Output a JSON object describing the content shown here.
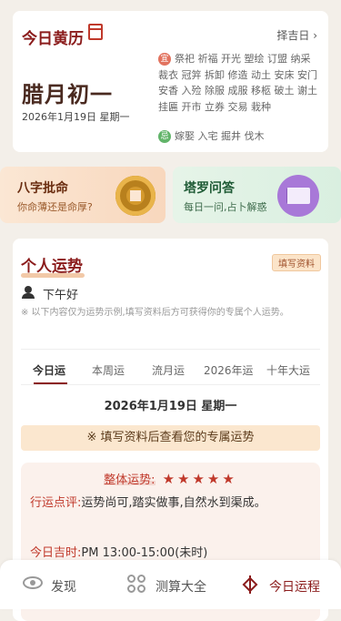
{
  "huangli": {
    "title": "今日黄历",
    "link": "择吉日 ›",
    "lunar": "腊月初一",
    "date": "2026年1月19日 星期一",
    "yi_badge": "宜",
    "yi": "祭祀 祈福 开光 塑绘 订盟 纳采 裁衣 冠笄 拆卸 修造 动土 安床 安门 安香 入殓 除服 成服 移柩 破土 谢土 挂匾 开市 立券 交易 栽种",
    "ji_badge": "忌",
    "ji": "嫁娶 入宅 掘井 伐木"
  },
  "promo_bazi": {
    "title": "八字批命",
    "subtitle": "你命薄还是命厚?"
  },
  "promo_tarot": {
    "title": "塔罗问答",
    "subtitle": "每日一问,占卜解惑"
  },
  "yunshi": {
    "title": "个人运势",
    "fill_tag": "填写资料",
    "greeting": "下午好",
    "notice": "※ 以下内容仅为运势示例,填写资料后方可获得你的专属个人运势。",
    "tabs": [
      "今日运",
      "本周运",
      "流月运",
      "2026年运",
      "十年大运"
    ],
    "date": "2026年1月19日 星期一",
    "hint": "※ 填写资料后查看您的专属运势",
    "overall_label": "整体运势:",
    "stars": "★★★★★",
    "rating": 5,
    "comment_label": "行运点评:",
    "comment": "运势尚可,踏实做事,自然水到渠成。",
    "lucky_label": "今日吉时:",
    "lucky": "PM 13:00-15:00(未时)"
  },
  "nav": {
    "discover": "发现",
    "tools": "测算大全",
    "today": "今日运程"
  },
  "colors": {
    "accent": "#8b1c1c",
    "yi": "#e2735f",
    "ji": "#62b46a",
    "star": "#c0392b"
  }
}
